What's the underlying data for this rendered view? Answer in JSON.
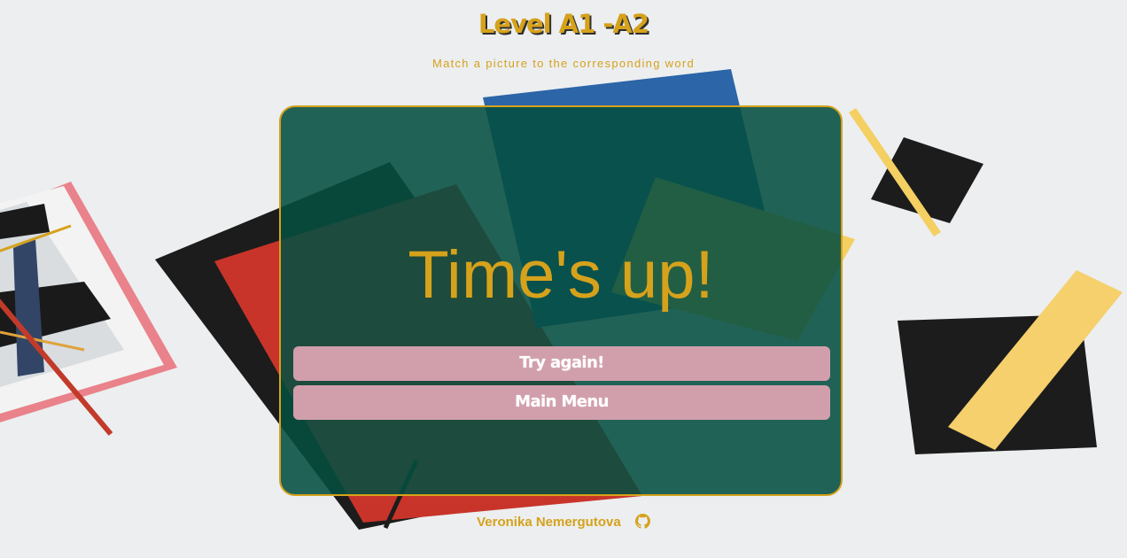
{
  "header": {
    "title": "Level A1 -A2",
    "subtitle": "Match a picture to the corresponding word"
  },
  "modal": {
    "message": "Time's up!",
    "try_again_label": "Try again!",
    "main_menu_label": "Main Menu"
  },
  "footer": {
    "author": "Veronika Nemergutova",
    "link_icon": "github-icon"
  },
  "colors": {
    "accent": "#d6a21b",
    "card_bg": "#044e40",
    "button_bg": "#d19fac",
    "page_bg": "#eceef0"
  }
}
